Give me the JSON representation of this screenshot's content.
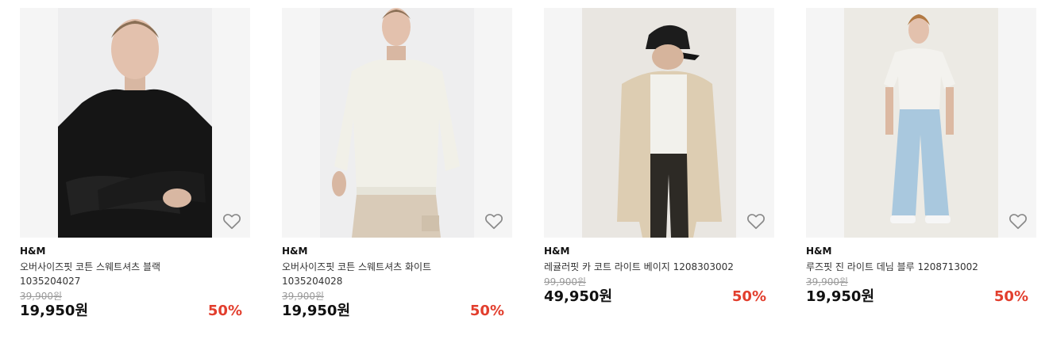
{
  "products": [
    {
      "brand": "H&M",
      "title_line1": "오버사이즈핏 코튼 스웨트셔츠 블랙",
      "title_line2": "1035204027",
      "original_price": "39,900원",
      "price": "19,950원",
      "discount": "50%",
      "wishlist_icon": "heart-outline-icon",
      "image": "model-black-sweatshirt-arms-crossed"
    },
    {
      "brand": "H&M",
      "title_line1": "오버사이즈핏 코튼 스웨트셔츠 화이트",
      "title_line2": "1035204028",
      "original_price": "39,900원",
      "price": "19,950원",
      "discount": "50%",
      "wishlist_icon": "heart-outline-icon",
      "image": "model-white-sweatshirt-beige-pants"
    },
    {
      "brand": "H&M",
      "title_line1": "레귤러핏 카 코트 라이트 베이지 1208303002",
      "title_line2": "",
      "original_price": "99,900원",
      "price": "49,950원",
      "discount": "50%",
      "wishlist_icon": "heart-outline-icon",
      "image": "model-beige-coat-black-cap"
    },
    {
      "brand": "H&M",
      "title_line1": "루즈핏 진 라이트 데님 블루 1208713002",
      "title_line2": "",
      "original_price": "39,900원",
      "price": "19,950원",
      "discount": "50%",
      "wishlist_icon": "heart-outline-icon",
      "image": "model-white-tee-light-jeans"
    }
  ],
  "colors": {
    "discount": "#e23e2d",
    "original_price": "#9a9a9a",
    "card_background": "#f5f5f5"
  }
}
